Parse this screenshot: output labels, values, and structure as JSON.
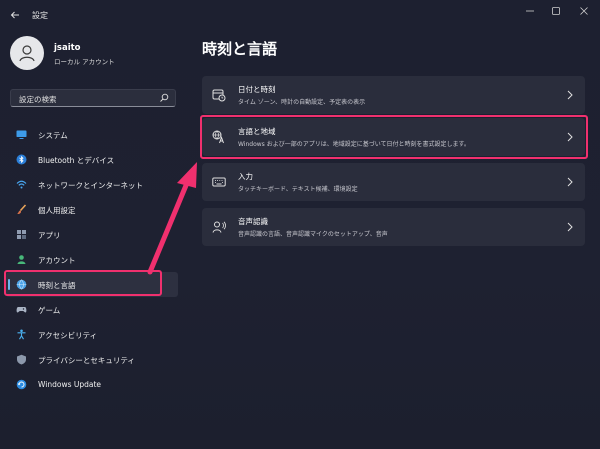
{
  "window": {
    "title": "設定"
  },
  "user": {
    "name": "jsaito",
    "account_type": "ローカル アカウント"
  },
  "search": {
    "placeholder": "設定の検索"
  },
  "nav": {
    "items": [
      {
        "label": "システム",
        "icon": "monitor-icon"
      },
      {
        "label": "Bluetooth とデバイス",
        "icon": "bluetooth-icon"
      },
      {
        "label": "ネットワークとインターネット",
        "icon": "wifi-icon"
      },
      {
        "label": "個人用設定",
        "icon": "brush-icon"
      },
      {
        "label": "アプリ",
        "icon": "apps-icon"
      },
      {
        "label": "アカウント",
        "icon": "person-icon"
      },
      {
        "label": "時刻と言語",
        "icon": "globe-clock-icon",
        "active": true
      },
      {
        "label": "ゲーム",
        "icon": "gamepad-icon"
      },
      {
        "label": "アクセシビリティ",
        "icon": "accessibility-icon"
      },
      {
        "label": "プライバシーとセキュリティ",
        "icon": "shield-icon"
      },
      {
        "label": "Windows Update",
        "icon": "update-icon"
      }
    ]
  },
  "main": {
    "title": "時刻と言語",
    "cards": [
      {
        "title": "日付と時刻",
        "desc": "タイム ゾーン、時計の自動設定、予定表の表示",
        "icon": "calendar-clock-icon"
      },
      {
        "title": "言語と地域",
        "desc": "Windows および一部のアプリは、地域設定に基づいて日付と時刻を書式設定します。",
        "icon": "language-region-icon"
      },
      {
        "title": "入力",
        "desc": "タッチキーボード、テキスト候補、環境設定",
        "icon": "keyboard-icon"
      },
      {
        "title": "音声認識",
        "desc": "音声認識の言語、音声認識マイクのセットアップ、音声",
        "icon": "speech-icon"
      }
    ]
  },
  "colors": {
    "accent": "#6cb4ef",
    "highlight": "#f0306e",
    "background": "#1e2131",
    "card": "#2a2d3c"
  }
}
